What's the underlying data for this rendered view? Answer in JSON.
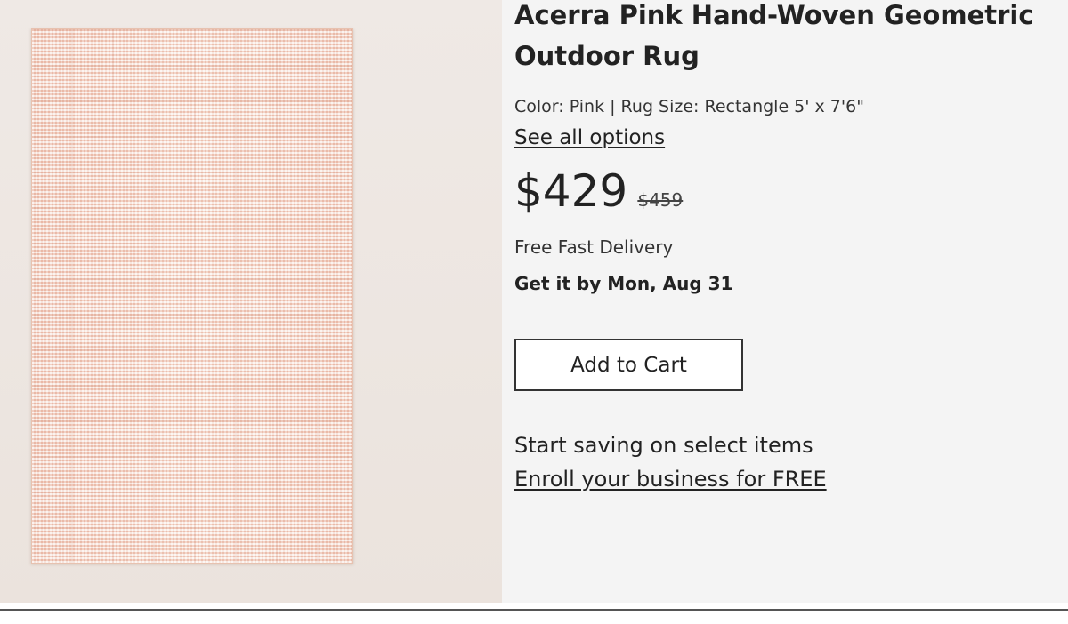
{
  "product": {
    "title_line1": "Acerra Pink Hand-Woven Geometric",
    "title_line2": "Outdoor Rug",
    "variant": "Color: Pink | Rug Size: Rectangle 5' x 7'6\"",
    "see_all_options": "See all options",
    "price": "$429",
    "original_price": "$459",
    "delivery": "Free Fast Delivery",
    "eta": "Get it by Mon, Aug 31",
    "add_to_cart": "Add to Cart"
  },
  "business": {
    "promo": "Start saving on select items",
    "enroll": "Enroll your business for FREE"
  },
  "colors": {
    "panel_background": "#f4f4f4",
    "rug_pink": "#f3d8c9",
    "text": "#222222"
  }
}
